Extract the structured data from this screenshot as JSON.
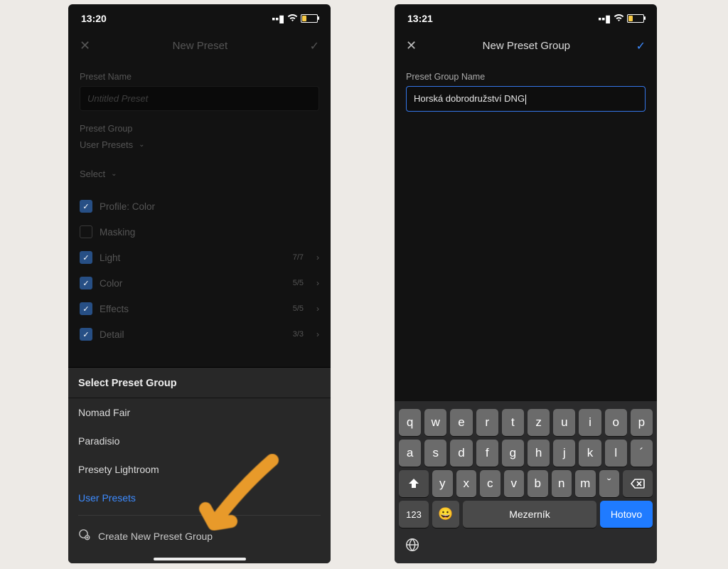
{
  "left": {
    "status": {
      "time": "13:20"
    },
    "header": {
      "title": "New Preset"
    },
    "preset_name_label": "Preset Name",
    "preset_name_placeholder": "Untitled Preset",
    "preset_group_label": "Preset Group",
    "preset_group_value": "User Presets",
    "select_label": "Select",
    "options": [
      {
        "label": "Profile: Color",
        "checked": true,
        "count": ""
      },
      {
        "label": "Masking",
        "checked": false,
        "count": ""
      },
      {
        "label": "Light",
        "checked": true,
        "count": "7/7"
      },
      {
        "label": "Color",
        "checked": true,
        "count": "5/5"
      },
      {
        "label": "Effects",
        "checked": true,
        "count": "5/5"
      },
      {
        "label": "Detail",
        "checked": true,
        "count": "3/3"
      }
    ],
    "sheet": {
      "title": "Select Preset Group",
      "items": [
        "Nomad Fair",
        "Paradisio",
        "Presety Lightroom",
        "User Presets"
      ],
      "create_label": "Create New Preset Group"
    }
  },
  "right": {
    "status": {
      "time": "13:21"
    },
    "header": {
      "title": "New Preset Group"
    },
    "group_name_label": "Preset Group Name",
    "group_name_value": "Horská dobrodružství DNG",
    "keyboard": {
      "row1": [
        "q",
        "w",
        "e",
        "r",
        "t",
        "z",
        "u",
        "i",
        "o",
        "p"
      ],
      "row2": [
        "a",
        "s",
        "d",
        "f",
        "g",
        "h",
        "j",
        "k",
        "l",
        "´"
      ],
      "row3": [
        "y",
        "x",
        "c",
        "v",
        "b",
        "n",
        "m",
        "ˇ"
      ],
      "numeric_label": "123",
      "space_label": "Mezerník",
      "done_label": "Hotovo"
    }
  }
}
